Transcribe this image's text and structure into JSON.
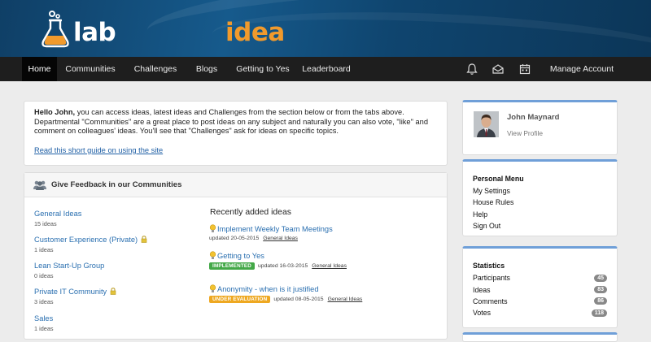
{
  "brand": {
    "name_part1": "idea",
    "name_part2": "lab"
  },
  "nav": {
    "items": [
      {
        "label": "Home",
        "active": true
      },
      {
        "label": "Communities",
        "active": false
      },
      {
        "label": "Challenges",
        "active": false
      },
      {
        "label": "Blogs",
        "active": false
      },
      {
        "label": "Getting to Yes",
        "active": false
      },
      {
        "label": "Leaderboard",
        "active": false
      }
    ],
    "icons": [
      "bell-icon",
      "mail-icon",
      "calendar-icon"
    ],
    "account_label": "Manage Account"
  },
  "welcome": {
    "greeting": "Hello John,",
    "text_1": " you can access ideas, latest ideas and Challenges from the section below or from the tabs above. Departmental \"Communities\" are a great place to post ideas on any subject and naturally you can also vote, \"like\" and comment on colleagues' ideas. You'll see that \"Challenges\" ask for ideas on specific topics.",
    "guide_link": "Read this short guide on using the site"
  },
  "feedback": {
    "title": "Give Feedback in our Communities",
    "communities": [
      {
        "name": "General Ideas",
        "count": "15 ideas",
        "private": false
      },
      {
        "name": "Customer Experience (Private)",
        "count": "1 ideas",
        "private": true
      },
      {
        "name": "Lean Start-Up Group",
        "count": "0 ideas",
        "private": false
      },
      {
        "name": "Private IT Community",
        "count": "3 ideas",
        "private": true
      },
      {
        "name": "Sales",
        "count": "1 ideas",
        "private": false
      }
    ],
    "recent_title": "Recently added ideas",
    "recent": [
      {
        "title": "Implement Weekly Team Meetings",
        "badge": "",
        "updated": "updated 20-05-2015",
        "category": "General Ideas"
      },
      {
        "title": "Getting to Yes",
        "badge": "IMPLEMENTED",
        "updated": "updated 16-03-2015",
        "category": "General Ideas"
      },
      {
        "title": "Anonymity - when is it justified",
        "badge": "UNDER EVALUATION",
        "updated": "updated 08-05-2015",
        "category": "General Ideas"
      }
    ]
  },
  "profile": {
    "name": "John Maynard",
    "link": "View Profile"
  },
  "personal_menu": {
    "title": "Personal Menu",
    "items": [
      "My Settings",
      "House Rules",
      "Help",
      "Sign Out"
    ]
  },
  "statistics": {
    "title": "Statistics",
    "rows": [
      {
        "label": "Participants",
        "value": "45"
      },
      {
        "label": "Ideas",
        "value": "83"
      },
      {
        "label": "Comments",
        "value": "86"
      },
      {
        "label": "Votes",
        "value": "118"
      }
    ]
  },
  "colors": {
    "brand_orange": "#f19a2c",
    "nav_bg": "#1e1e1e",
    "link_blue": "#2a6fb0",
    "implemented_green": "#43a847",
    "evaluation_orange": "#eea821"
  }
}
